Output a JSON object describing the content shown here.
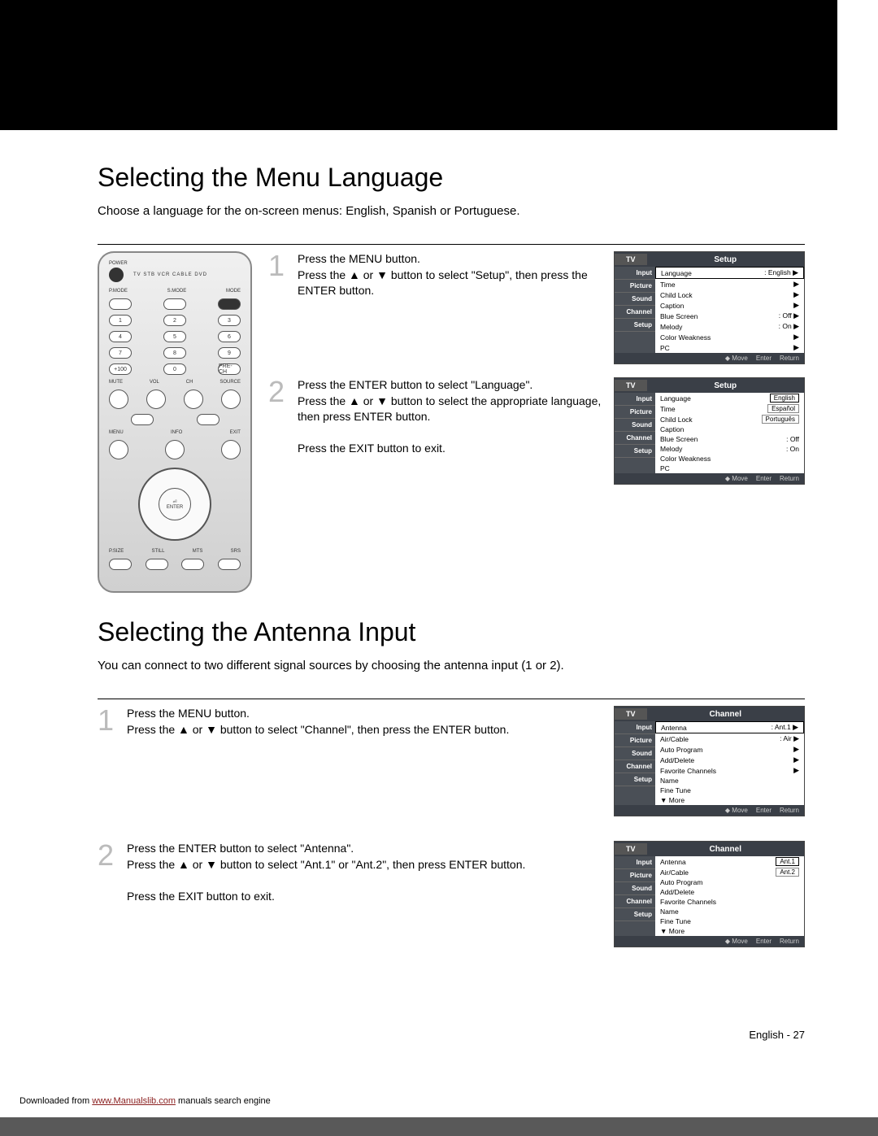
{
  "section1": {
    "heading": "Selecting the Menu Language",
    "intro": "Choose a language for the on-screen menus: English, Spanish or Portuguese.",
    "step1": {
      "num": "1",
      "text": "Press the MENU button.\nPress the ▲ or ▼ button to select \"Setup\", then press the ENTER button."
    },
    "step2": {
      "num": "2",
      "text": "Press the ENTER button to select \"Language\".\nPress the ▲ or ▼ button to select the appropriate language, then press ENTER button.",
      "exit": "Press the EXIT button to exit."
    }
  },
  "section2": {
    "heading": "Selecting the Antenna Input",
    "intro": "You can connect to two different signal sources by choosing the antenna input (1 or 2).",
    "step1": {
      "num": "1",
      "text": "Press the MENU button.\nPress the ▲ or ▼ button to select \"Channel\", then press the ENTER button."
    },
    "step2": {
      "num": "2",
      "text": "Press the ENTER button to select \"Antenna\".\nPress the ▲ or ▼ button to select \"Ant.1\" or \"Ant.2\", then press ENTER button.",
      "exit": "Press the EXIT button to exit."
    }
  },
  "osd": {
    "tv": "TV",
    "setup": "Setup",
    "channel": "Channel",
    "sidebar": [
      "Input",
      "Picture",
      "Sound",
      "Channel",
      "Setup"
    ],
    "foot": {
      "move": "◆ Move",
      "enter": "Enter",
      "return": "Return"
    },
    "setup_items": [
      {
        "k": "Language",
        "v": ": English"
      },
      {
        "k": "Time",
        "v": ""
      },
      {
        "k": "Child Lock",
        "v": ""
      },
      {
        "k": "Caption",
        "v": ""
      },
      {
        "k": "Blue Screen",
        "v": ": Off"
      },
      {
        "k": "Melody",
        "v": ": On"
      },
      {
        "k": "Color Weakness",
        "v": ""
      },
      {
        "k": "PC",
        "v": ""
      }
    ],
    "lang_opts": [
      "English",
      "Español",
      "Português"
    ],
    "channel_items": [
      {
        "k": "Antenna",
        "v": ": Ant.1"
      },
      {
        "k": "Air/Cable",
        "v": ": Air"
      },
      {
        "k": "Auto Program",
        "v": ""
      },
      {
        "k": "Add/Delete",
        "v": ""
      },
      {
        "k": "Favorite Channels",
        "v": ""
      },
      {
        "k": "Name",
        "v": ""
      },
      {
        "k": "Fine Tune",
        "v": ""
      },
      {
        "k": "  ▼ More",
        "v": ""
      }
    ],
    "ant_opts": [
      "Ant.1",
      "Ant.2"
    ],
    "channel_items2": [
      {
        "k": "Antenna",
        "v": ""
      },
      {
        "k": "Air/Cable",
        "v": ""
      },
      {
        "k": "Auto Program",
        "v": ""
      },
      {
        "k": "Add/Delete",
        "v": ""
      },
      {
        "k": "Favorite Channels",
        "v": ""
      },
      {
        "k": "Name",
        "v": ""
      },
      {
        "k": "Fine Tune",
        "v": ""
      },
      {
        "k": "  ▼ More",
        "v": ""
      }
    ]
  },
  "remote": {
    "labels_top": "TV  STB  VCR  CABLE  DVD",
    "labels_row2": [
      "P.MODE",
      "S.MODE",
      "MODE"
    ],
    "pads": [
      [
        "1",
        "2",
        "3"
      ],
      [
        "4",
        "5",
        "6"
      ],
      [
        "7",
        "8",
        "9"
      ],
      [
        "+100",
        "0",
        "PRE-CH"
      ]
    ],
    "vol": "VOL",
    "ch": "CH",
    "mute": "MUTE",
    "source": "SOURCE",
    "info": "INFO",
    "menu": "MENU",
    "exit": "EXIT",
    "enter": "ENTER",
    "bottom": [
      "P.SIZE",
      "STILL",
      "MTS",
      "SRS"
    ],
    "power": "POWER"
  },
  "footer": "English - 27",
  "download": {
    "pre": "Downloaded from ",
    "link": "www.Manualslib.com",
    "post": " manuals search engine"
  }
}
